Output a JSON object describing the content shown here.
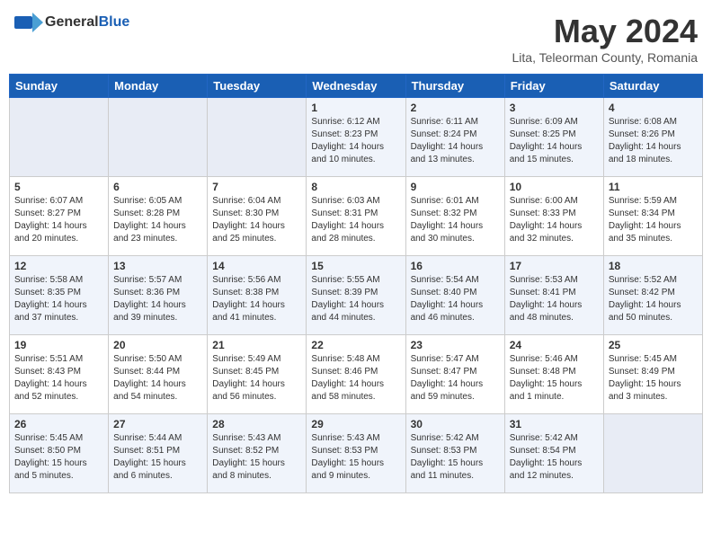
{
  "header": {
    "logo": {
      "general": "General",
      "blue": "Blue",
      "tagline": ""
    },
    "title": "May 2024",
    "location": "Lita, Teleorman County, Romania"
  },
  "weekdays": [
    "Sunday",
    "Monday",
    "Tuesday",
    "Wednesday",
    "Thursday",
    "Friday",
    "Saturday"
  ],
  "weeks": [
    [
      {
        "day": "",
        "sunrise": "",
        "sunset": "",
        "daylight": ""
      },
      {
        "day": "",
        "sunrise": "",
        "sunset": "",
        "daylight": ""
      },
      {
        "day": "",
        "sunrise": "",
        "sunset": "",
        "daylight": ""
      },
      {
        "day": "1",
        "sunrise": "Sunrise: 6:12 AM",
        "sunset": "Sunset: 8:23 PM",
        "daylight": "Daylight: 14 hours and 10 minutes."
      },
      {
        "day": "2",
        "sunrise": "Sunrise: 6:11 AM",
        "sunset": "Sunset: 8:24 PM",
        "daylight": "Daylight: 14 hours and 13 minutes."
      },
      {
        "day": "3",
        "sunrise": "Sunrise: 6:09 AM",
        "sunset": "Sunset: 8:25 PM",
        "daylight": "Daylight: 14 hours and 15 minutes."
      },
      {
        "day": "4",
        "sunrise": "Sunrise: 6:08 AM",
        "sunset": "Sunset: 8:26 PM",
        "daylight": "Daylight: 14 hours and 18 minutes."
      }
    ],
    [
      {
        "day": "5",
        "sunrise": "Sunrise: 6:07 AM",
        "sunset": "Sunset: 8:27 PM",
        "daylight": "Daylight: 14 hours and 20 minutes."
      },
      {
        "day": "6",
        "sunrise": "Sunrise: 6:05 AM",
        "sunset": "Sunset: 8:28 PM",
        "daylight": "Daylight: 14 hours and 23 minutes."
      },
      {
        "day": "7",
        "sunrise": "Sunrise: 6:04 AM",
        "sunset": "Sunset: 8:30 PM",
        "daylight": "Daylight: 14 hours and 25 minutes."
      },
      {
        "day": "8",
        "sunrise": "Sunrise: 6:03 AM",
        "sunset": "Sunset: 8:31 PM",
        "daylight": "Daylight: 14 hours and 28 minutes."
      },
      {
        "day": "9",
        "sunrise": "Sunrise: 6:01 AM",
        "sunset": "Sunset: 8:32 PM",
        "daylight": "Daylight: 14 hours and 30 minutes."
      },
      {
        "day": "10",
        "sunrise": "Sunrise: 6:00 AM",
        "sunset": "Sunset: 8:33 PM",
        "daylight": "Daylight: 14 hours and 32 minutes."
      },
      {
        "day": "11",
        "sunrise": "Sunrise: 5:59 AM",
        "sunset": "Sunset: 8:34 PM",
        "daylight": "Daylight: 14 hours and 35 minutes."
      }
    ],
    [
      {
        "day": "12",
        "sunrise": "Sunrise: 5:58 AM",
        "sunset": "Sunset: 8:35 PM",
        "daylight": "Daylight: 14 hours and 37 minutes."
      },
      {
        "day": "13",
        "sunrise": "Sunrise: 5:57 AM",
        "sunset": "Sunset: 8:36 PM",
        "daylight": "Daylight: 14 hours and 39 minutes."
      },
      {
        "day": "14",
        "sunrise": "Sunrise: 5:56 AM",
        "sunset": "Sunset: 8:38 PM",
        "daylight": "Daylight: 14 hours and 41 minutes."
      },
      {
        "day": "15",
        "sunrise": "Sunrise: 5:55 AM",
        "sunset": "Sunset: 8:39 PM",
        "daylight": "Daylight: 14 hours and 44 minutes."
      },
      {
        "day": "16",
        "sunrise": "Sunrise: 5:54 AM",
        "sunset": "Sunset: 8:40 PM",
        "daylight": "Daylight: 14 hours and 46 minutes."
      },
      {
        "day": "17",
        "sunrise": "Sunrise: 5:53 AM",
        "sunset": "Sunset: 8:41 PM",
        "daylight": "Daylight: 14 hours and 48 minutes."
      },
      {
        "day": "18",
        "sunrise": "Sunrise: 5:52 AM",
        "sunset": "Sunset: 8:42 PM",
        "daylight": "Daylight: 14 hours and 50 minutes."
      }
    ],
    [
      {
        "day": "19",
        "sunrise": "Sunrise: 5:51 AM",
        "sunset": "Sunset: 8:43 PM",
        "daylight": "Daylight: 14 hours and 52 minutes."
      },
      {
        "day": "20",
        "sunrise": "Sunrise: 5:50 AM",
        "sunset": "Sunset: 8:44 PM",
        "daylight": "Daylight: 14 hours and 54 minutes."
      },
      {
        "day": "21",
        "sunrise": "Sunrise: 5:49 AM",
        "sunset": "Sunset: 8:45 PM",
        "daylight": "Daylight: 14 hours and 56 minutes."
      },
      {
        "day": "22",
        "sunrise": "Sunrise: 5:48 AM",
        "sunset": "Sunset: 8:46 PM",
        "daylight": "Daylight: 14 hours and 58 minutes."
      },
      {
        "day": "23",
        "sunrise": "Sunrise: 5:47 AM",
        "sunset": "Sunset: 8:47 PM",
        "daylight": "Daylight: 14 hours and 59 minutes."
      },
      {
        "day": "24",
        "sunrise": "Sunrise: 5:46 AM",
        "sunset": "Sunset: 8:48 PM",
        "daylight": "Daylight: 15 hours and 1 minute."
      },
      {
        "day": "25",
        "sunrise": "Sunrise: 5:45 AM",
        "sunset": "Sunset: 8:49 PM",
        "daylight": "Daylight: 15 hours and 3 minutes."
      }
    ],
    [
      {
        "day": "26",
        "sunrise": "Sunrise: 5:45 AM",
        "sunset": "Sunset: 8:50 PM",
        "daylight": "Daylight: 15 hours and 5 minutes."
      },
      {
        "day": "27",
        "sunrise": "Sunrise: 5:44 AM",
        "sunset": "Sunset: 8:51 PM",
        "daylight": "Daylight: 15 hours and 6 minutes."
      },
      {
        "day": "28",
        "sunrise": "Sunrise: 5:43 AM",
        "sunset": "Sunset: 8:52 PM",
        "daylight": "Daylight: 15 hours and 8 minutes."
      },
      {
        "day": "29",
        "sunrise": "Sunrise: 5:43 AM",
        "sunset": "Sunset: 8:53 PM",
        "daylight": "Daylight: 15 hours and 9 minutes."
      },
      {
        "day": "30",
        "sunrise": "Sunrise: 5:42 AM",
        "sunset": "Sunset: 8:53 PM",
        "daylight": "Daylight: 15 hours and 11 minutes."
      },
      {
        "day": "31",
        "sunrise": "Sunrise: 5:42 AM",
        "sunset": "Sunset: 8:54 PM",
        "daylight": "Daylight: 15 hours and 12 minutes."
      },
      {
        "day": "",
        "sunrise": "",
        "sunset": "",
        "daylight": ""
      }
    ]
  ]
}
